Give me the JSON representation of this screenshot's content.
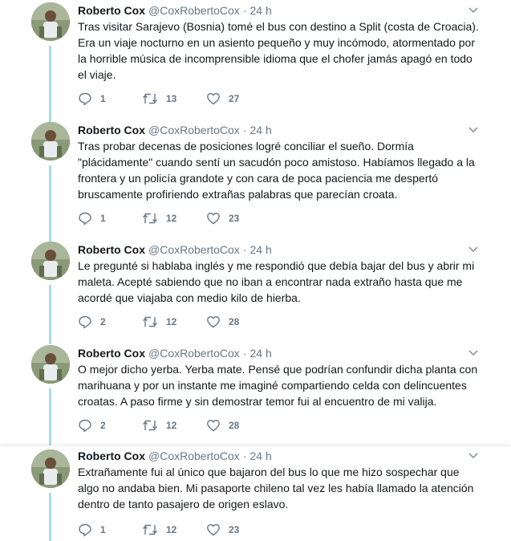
{
  "tweets": [
    {
      "name": "Roberto Cox",
      "handle": "@CoxRobertoCox",
      "dot": "·",
      "time": "24 h",
      "text": "Tras visitar Sarajevo (Bosnia) tomé el bus con destino a Split (costa de Croacia). Era un viaje nocturno en un asiento pequeño y muy incómodo, atormentado por la horrible música de incomprensible idioma que el chofer jamás apagó en todo el viaje.",
      "replies": "1",
      "retweets": "13",
      "likes": "27"
    },
    {
      "name": "Roberto Cox",
      "handle": "@CoxRobertoCox",
      "dot": "·",
      "time": "24 h",
      "text": "Tras probar decenas de posiciones logré conciliar el sueño. Dormía \"plácidamente\" cuando sentí un sacudón poco amistoso. Habíamos llegado a la frontera y un policía grandote y con cara de poca paciencia me despertó bruscamente profiriendo extrañas palabras que parecían croata.",
      "replies": "1",
      "retweets": "12",
      "likes": "23"
    },
    {
      "name": "Roberto Cox",
      "handle": "@CoxRobertoCox",
      "dot": "·",
      "time": "24 h",
      "text": "Le pregunté si hablaba inglés y me respondió que debía bajar del bus y abrir mi maleta. Acepté sabiendo que no iban a encontrar nada extraño hasta que me acordé que viajaba con medio kilo de hierba.",
      "replies": "2",
      "retweets": "12",
      "likes": "28"
    },
    {
      "name": "Roberto Cox",
      "handle": "@CoxRobertoCox",
      "dot": "·",
      "time": "24 h",
      "text": "O mejor dicho yerba. Yerba mate. Pensé que podrían confundir dicha planta con marihuana y por un instante me imaginé compartiendo celda con delincuentes croatas. A paso firme y sin demostrar temor fui al encuentro de mi valija.",
      "replies": "2",
      "retweets": "12",
      "likes": "28"
    },
    {
      "name": "Roberto Cox",
      "handle": "@CoxRobertoCox",
      "dot": "·",
      "time": "24 h",
      "text": "Extrañamente fui al único que bajaron del bus lo que me hizo sospechar que algo no andaba bien. Mi pasaporte chileno tal vez les había llamado la atención dentro de tanto pasajero de origen eslavo.",
      "replies": "1",
      "retweets": "12",
      "likes": "23"
    }
  ],
  "icons": {
    "reply": "reply-icon",
    "retweet": "retweet-icon",
    "like": "heart-icon",
    "caret": "chevron-down-icon"
  },
  "colors": {
    "thread_line": "#a8dde6",
    "secondary_text": "#657786",
    "primary_text": "#14171a"
  }
}
